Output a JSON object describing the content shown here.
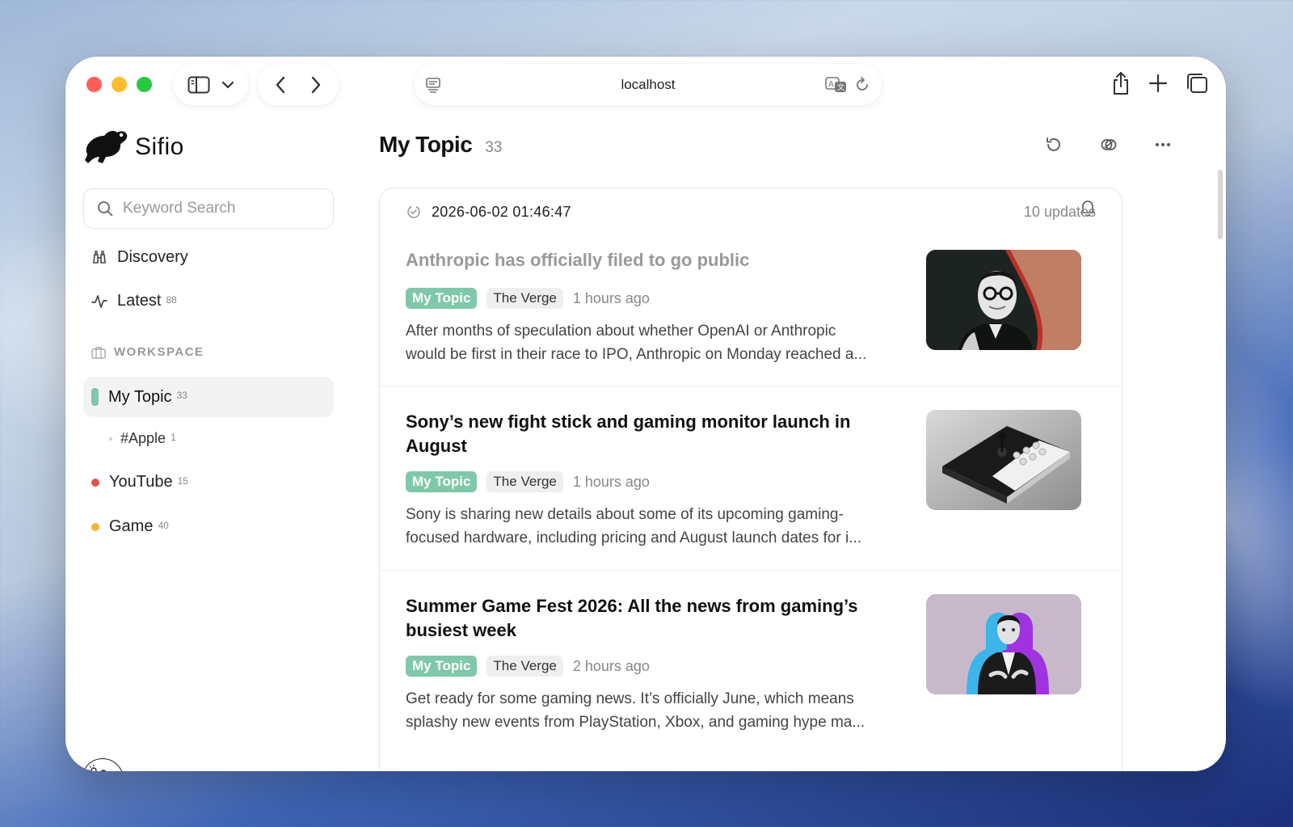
{
  "browser": {
    "address": "localhost"
  },
  "app": {
    "name": "Sifio"
  },
  "search": {
    "placeholder": "Keyword Search"
  },
  "nav": {
    "discovery": "Discovery",
    "latest": "Latest",
    "latest_count": "88",
    "workspace_label": "WORKSPACE"
  },
  "topics": {
    "active": {
      "label": "My Topic",
      "count": "33",
      "color": "#7fc8a9"
    },
    "sub": {
      "label": "#Apple",
      "count": "1"
    },
    "feeds": [
      {
        "label": "YouTube",
        "count": "15",
        "color": "#e5534b"
      },
      {
        "label": "Game",
        "count": "40",
        "color": "#f2b33d"
      }
    ]
  },
  "main": {
    "title": "My Topic",
    "count": "33",
    "timestamp": "2026-06-02 01:46:47",
    "updates": "10 updates",
    "articles": [
      {
        "title": "Anthropic has officially filed to go public",
        "topic": "My Topic",
        "source": "The Verge",
        "time": "1 hours ago",
        "snippet1": "After months of speculation about whether OpenAI or Anthropic",
        "snippet2": "would be first in their race to IPO, Anthropic on Monday reached a...",
        "read": true
      },
      {
        "title": "Sony’s new fight stick and gaming monitor launch in August",
        "topic": "My Topic",
        "source": "The Verge",
        "time": "1 hours ago",
        "snippet1": "Sony is sharing new details about some of its upcoming gaming-",
        "snippet2": "focused hardware, including pricing and August launch dates for i...",
        "read": false
      },
      {
        "title": "Summer Game Fest 2026: All the news from gaming’s busiest week",
        "topic": "My Topic",
        "source": "The Verge",
        "time": "2 hours ago",
        "snippet1": "Get ready for some gaming news. It’s officially June, which means",
        "snippet2": "splashy new events from PlayStation, Xbox, and gaming hype ma...",
        "read": false
      }
    ]
  },
  "colors": {
    "accent": "#7fc8a9",
    "youtube": "#e5534b",
    "game": "#f2b33d"
  }
}
